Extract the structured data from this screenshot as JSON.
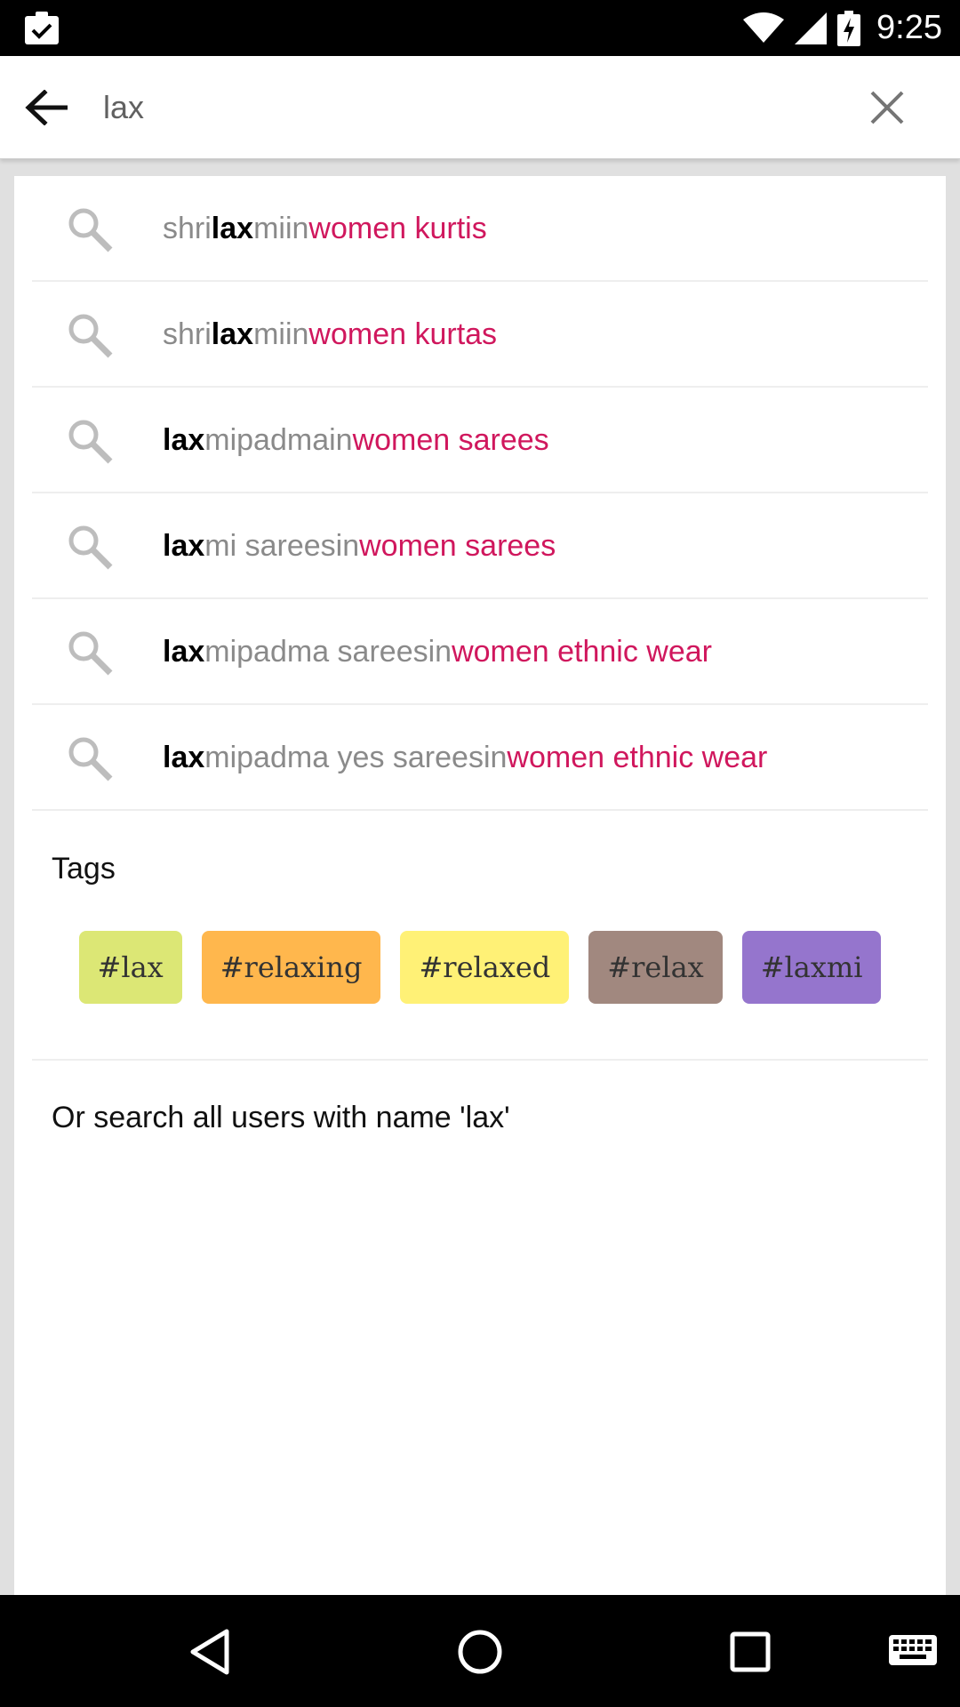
{
  "status_bar": {
    "time": "9:25",
    "left_icon": "clipboard-check-icon",
    "icons": [
      "wifi-icon",
      "signal-icon",
      "battery-charging-icon"
    ]
  },
  "search": {
    "query": "lax",
    "back_icon": "arrow-back-icon",
    "clear_icon": "close-icon"
  },
  "suggestions": [
    {
      "pre": "shri ",
      "highlight": "lax",
      "rest": "mi",
      "in": " in ",
      "category": "women kurtis"
    },
    {
      "pre": "shri ",
      "highlight": "lax",
      "rest": "mi",
      "in": " in ",
      "category": "women kurtas"
    },
    {
      "pre": "",
      "highlight": "lax",
      "rest": "mipadma",
      "in": " in ",
      "category": "women sarees"
    },
    {
      "pre": "",
      "highlight": "lax",
      "rest": "mi sarees",
      "in": " in ",
      "category": "women sarees"
    },
    {
      "pre": "",
      "highlight": "lax",
      "rest": "mipadma sarees",
      "in": " in ",
      "category": "women ethnic wear"
    },
    {
      "pre": "",
      "highlight": "lax",
      "rest": "mipadma yes sarees",
      "in": " in ",
      "category": "women ethnic wear"
    }
  ],
  "tags_section": {
    "title": "Tags",
    "tags": [
      {
        "label": "#lax",
        "color": "#dce775"
      },
      {
        "label": "#relaxing",
        "color": "#ffb74d"
      },
      {
        "label": "#relaxed",
        "color": "#fff176"
      },
      {
        "label": "#relax",
        "color": "#a1887f"
      },
      {
        "label": "#laxmi",
        "color": "#9575cd"
      }
    ]
  },
  "search_users_text": "Or search all users with name 'lax'",
  "colors": {
    "accent": "#d0175d",
    "suggestion_text": "#8a8a8a"
  },
  "nav_bar": {
    "icons": [
      "back-triangle-icon",
      "home-circle-icon",
      "recents-square-icon",
      "keyboard-icon"
    ]
  }
}
